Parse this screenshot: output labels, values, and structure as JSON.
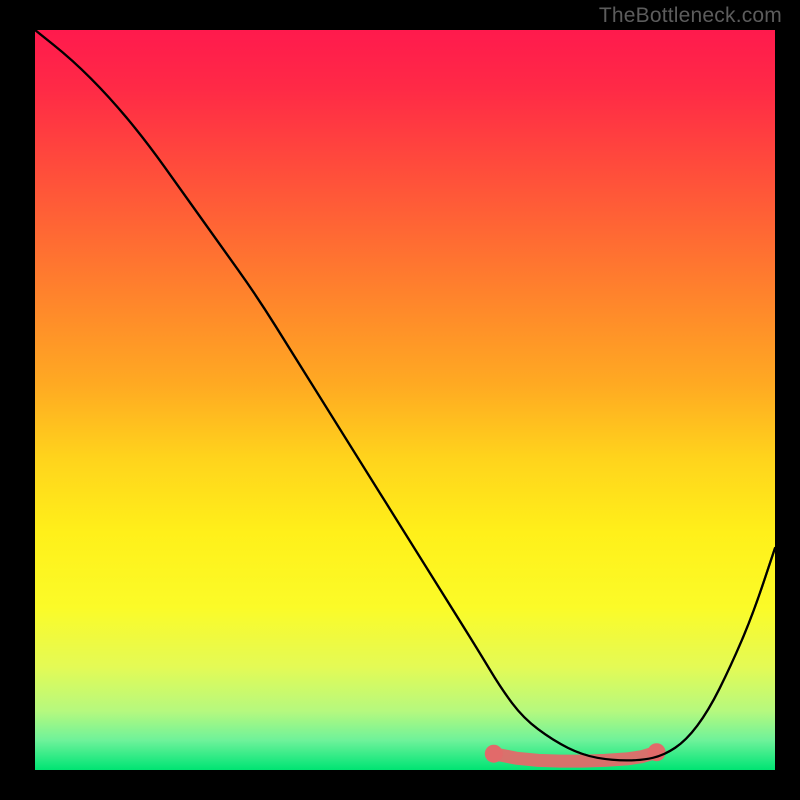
{
  "watermark": "TheBottleneck.com",
  "chart_data": {
    "type": "line",
    "title": "",
    "xlabel": "",
    "ylabel": "",
    "xlim": [
      0,
      100
    ],
    "ylim": [
      0,
      100
    ],
    "grid": false,
    "legend": false,
    "series": [
      {
        "name": "curve",
        "x": [
          0,
          5,
          10,
          15,
          20,
          25,
          30,
          35,
          40,
          45,
          50,
          55,
          60,
          63,
          66,
          70,
          74,
          78,
          82,
          85,
          88,
          91,
          94,
          97,
          100
        ],
        "y": [
          100,
          96,
          91,
          85,
          78,
          71,
          64,
          56,
          48,
          40,
          32,
          24,
          16,
          11,
          7,
          4,
          2,
          1.3,
          1.3,
          2,
          4,
          8,
          14,
          21,
          30
        ]
      }
    ],
    "markers": {
      "name": "bottom-cluster",
      "color": "#e26a6a",
      "x": [
        62,
        65,
        68,
        71,
        74,
        77,
        80,
        82,
        84
      ],
      "y": [
        2.2,
        1.6,
        1.3,
        1.2,
        1.2,
        1.3,
        1.5,
        1.8,
        2.4
      ]
    },
    "background_gradient": {
      "top": "#ff1a4d",
      "mid": "#ffe81a",
      "bottom": "#00e472"
    }
  }
}
